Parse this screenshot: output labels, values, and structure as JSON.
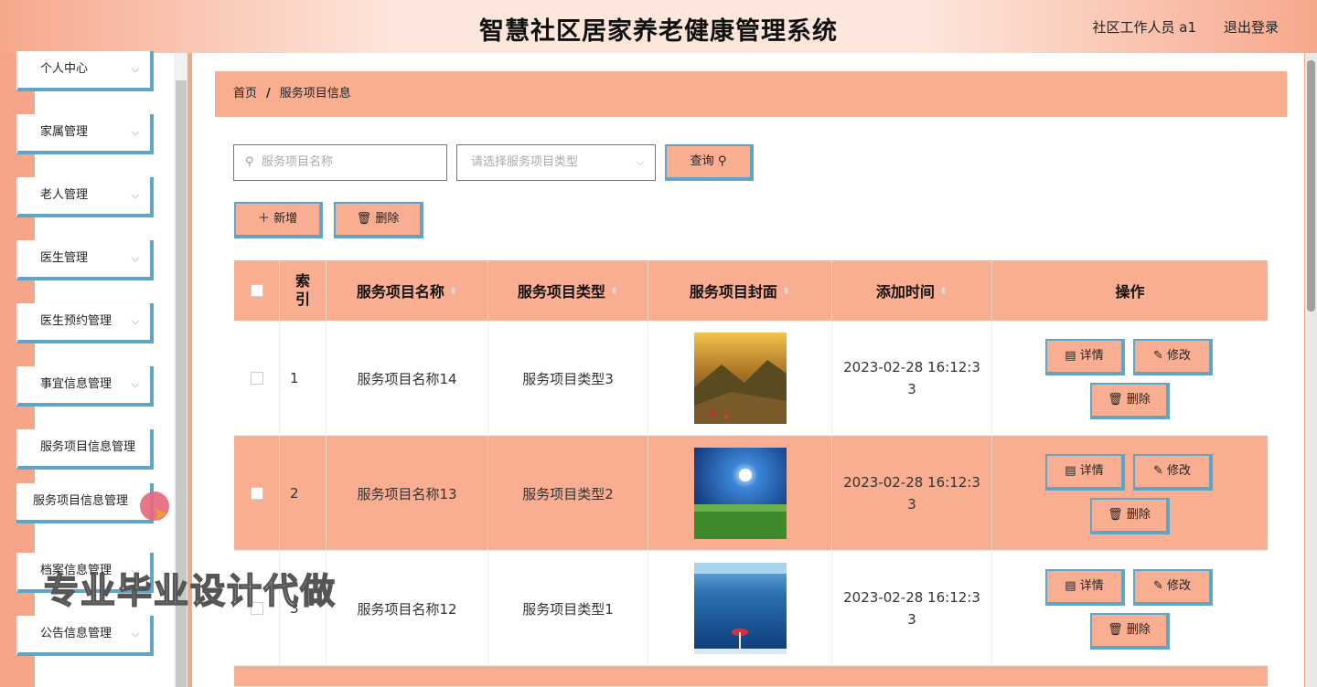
{
  "header": {
    "title": "智慧社区居家养老健康管理系统",
    "user": "社区工作人员 a1",
    "logout": "退出登录"
  },
  "sidebar": {
    "items": [
      {
        "label": "个人中心"
      },
      {
        "label": "家属管理"
      },
      {
        "label": "老人管理"
      },
      {
        "label": "医生管理"
      },
      {
        "label": "医生预约管理"
      },
      {
        "label": "事宜信息管理"
      },
      {
        "label": "服务项目信息管理"
      },
      {
        "label": "服务项目信息管理"
      },
      {
        "label": "档案信息管理"
      },
      {
        "label": "公告信息管理"
      }
    ]
  },
  "breadcrumb": {
    "home": "首页",
    "sep": "/",
    "current": "服务项目信息"
  },
  "search": {
    "name_placeholder": "服务项目名称",
    "type_placeholder": "请选择服务项目类型",
    "query_label": "查询"
  },
  "toolbar": {
    "add_label": "新增",
    "delete_label": "删除"
  },
  "table": {
    "headers": [
      "",
      "索引",
      "服务项目名称",
      "服务项目类型",
      "服务项目封面",
      "添加时间",
      "操作"
    ],
    "index_header": "索\n引",
    "rows": [
      {
        "index": "1",
        "name": "服务项目名称14",
        "type": "服务项目类型3",
        "time": "2023-02-28 16:12:33"
      },
      {
        "index": "2",
        "name": "服务项目名称13",
        "type": "服务项目类型2",
        "time": "2023-02-28 16:12:33"
      },
      {
        "index": "3",
        "name": "服务项目名称12",
        "type": "服务项目类型1",
        "time": "2023-02-28 16:12:33"
      }
    ],
    "actions": {
      "detail": "详情",
      "edit": "修改",
      "delete": "删除"
    }
  },
  "watermark": "专业毕业设计代做",
  "colors": {
    "accent": "#f9ad91",
    "border": "#5fa6c6"
  }
}
